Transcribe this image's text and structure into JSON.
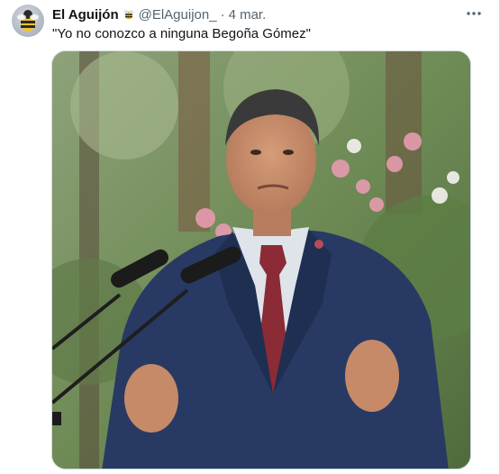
{
  "tweet": {
    "author": {
      "display_name": "El Aguijón",
      "badge_icon": "bee-icon",
      "handle": "@ElAguijon_",
      "separator": "·",
      "date": "4 mar."
    },
    "text": "\"Yo no conozco a ninguna Begoña Gómez\"",
    "more_icon": "more-horizontal-icon",
    "media": {
      "type": "photo",
      "subject": "man in suit at microphones"
    }
  },
  "colors": {
    "text_primary": "#0f1419",
    "text_secondary": "#536471",
    "border": "#cfd9de",
    "suit": "#283a63",
    "tie": "#8a2b36"
  }
}
